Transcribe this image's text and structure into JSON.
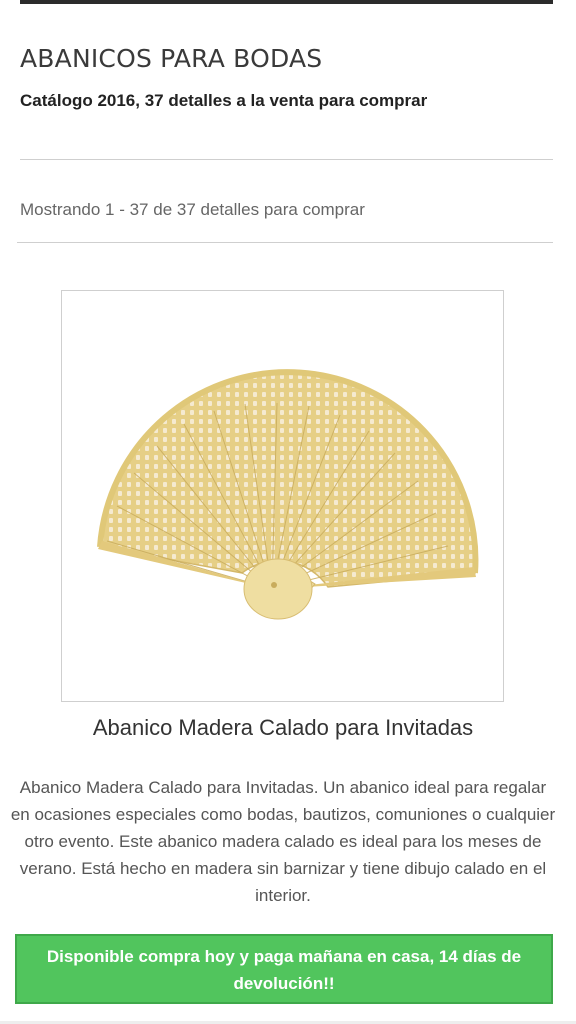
{
  "header": {
    "title": "ABANICOS PARA BODAS",
    "subtitle": "Catálogo 2016, 37 detalles a la venta para comprar"
  },
  "listing": {
    "count_text": "Mostrando 1 - 37 de 37 detalles para comprar"
  },
  "product": {
    "name": "Abanico Madera Calado para Invitadas",
    "image_icon": "wooden-fan-image",
    "description": "Abanico Madera Calado para Invitadas. Un abanico ideal para regalar en ocasiones especiales como bodas, bautizos, comuniones o cualquier otro evento. Este abanico madera calado es ideal para los meses de verano. Está hecho en madera sin barnizar y tiene dibujo calado en el interior."
  },
  "cta": {
    "label": "Disponible compra hoy y paga mañana en casa, 14 días de devolución!!",
    "color": "#51c55d"
  }
}
